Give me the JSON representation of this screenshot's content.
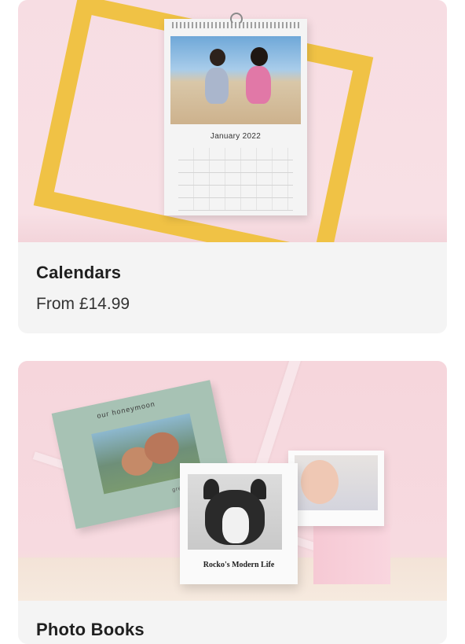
{
  "products": [
    {
      "title": "Calendars",
      "price": "From  £14.99",
      "calendar_month": "January 2022"
    },
    {
      "title": "Photo Books",
      "book_green_title": "our honeymoon",
      "book_green_subtitle": "greece 2021",
      "book_white_title": "Rocko's Modern Life"
    }
  ],
  "colors": {
    "frame_yellow": "#f0c245",
    "hero_pink": "#f7dde3",
    "card_bg": "#f4f4f4"
  }
}
